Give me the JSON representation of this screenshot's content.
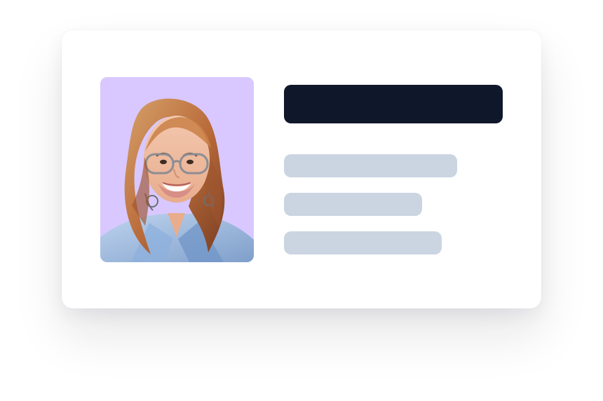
{
  "colors": {
    "avatar_background": "#d8c8ff",
    "title_placeholder": "#0f172a",
    "line_placeholder": "#cbd5e1",
    "card_background": "#ffffff"
  },
  "icons": {
    "avatar": "person-photo-icon"
  }
}
